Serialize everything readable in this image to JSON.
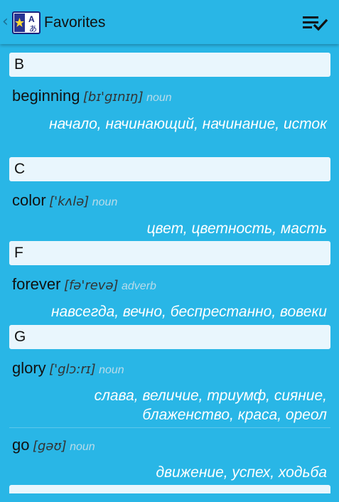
{
  "appbar": {
    "title": "Favorites",
    "logo_letters": [
      "A",
      "あ"
    ],
    "icons": {
      "back": "back-chevron-icon",
      "logo": "dictionary-logo-icon",
      "menu": "list-check-icon"
    }
  },
  "entries": [
    {
      "header": "B"
    },
    {
      "word": "beginning",
      "transcription": "[bɪ'gɪnɪŋ]",
      "pos": "noun",
      "meaning": "начало, начинающий, начинание, исток"
    },
    {
      "header": "C"
    },
    {
      "word": "color",
      "transcription": "['kʌlə]",
      "pos": "noun",
      "meaning": "цвет, цветность, масть"
    },
    {
      "header": "F"
    },
    {
      "word": "forever",
      "transcription": "[fə'revə]",
      "pos": "adverb",
      "meaning": "навсегда, вечно, беспрестанно, вовеки"
    },
    {
      "header": "G"
    },
    {
      "word": "glory",
      "transcription": "['glɔ:rɪ]",
      "pos": "noun",
      "meaning": "слава, величие, триумф, сияние, блаженство, краса, ореол"
    },
    {
      "word": "go",
      "transcription": "[gəʊ]",
      "pos": "noun",
      "meaning": "движение, успех, ходьба"
    }
  ],
  "colors": {
    "background": "#29b6e6",
    "header_bg": "#e9f6fd",
    "meaning_text": "#ffffff",
    "pos_text": "#b9dcea"
  }
}
